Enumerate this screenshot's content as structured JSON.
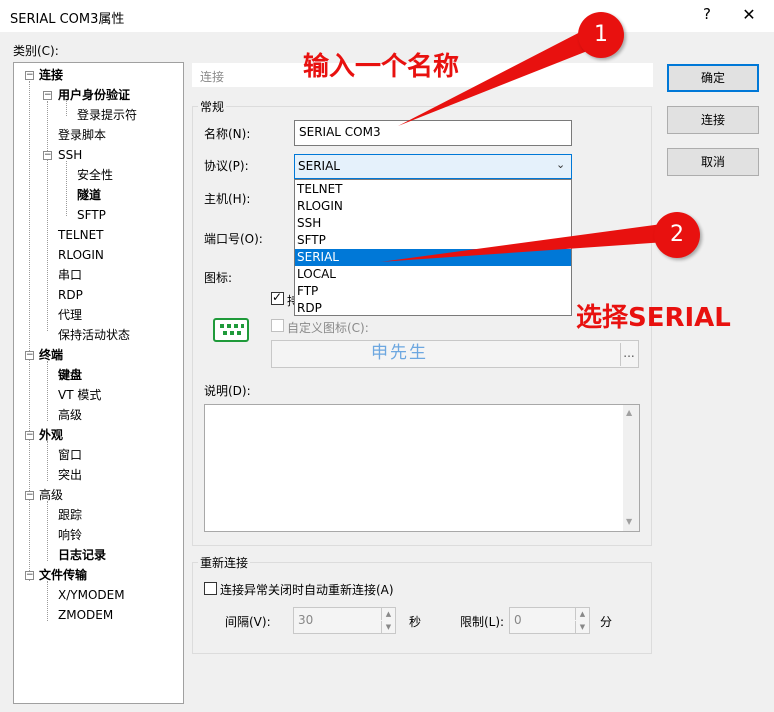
{
  "window": {
    "title": "SERIAL COM3属性",
    "help_glyph": "?",
    "close_glyph": "✕"
  },
  "category_label": "类别(C):",
  "tree": [
    {
      "label": "连接",
      "bold": true
    },
    {
      "label": "用户身份验证",
      "bold": true
    },
    {
      "label": "登录提示符",
      "bold": false
    },
    {
      "label": "登录脚本",
      "bold": false
    },
    {
      "label": "SSH",
      "bold": false
    },
    {
      "label": "安全性",
      "bold": false
    },
    {
      "label": "隧道",
      "bold": true
    },
    {
      "label": "SFTP",
      "bold": false
    },
    {
      "label": "TELNET",
      "bold": false
    },
    {
      "label": "RLOGIN",
      "bold": false
    },
    {
      "label": "串口",
      "bold": false
    },
    {
      "label": "RDP",
      "bold": false
    },
    {
      "label": "代理",
      "bold": false
    },
    {
      "label": "保持活动状态",
      "bold": false
    },
    {
      "label": "终端",
      "bold": true
    },
    {
      "label": "键盘",
      "bold": true
    },
    {
      "label": "VT 模式",
      "bold": false
    },
    {
      "label": "高级",
      "bold": false
    },
    {
      "label": "外观",
      "bold": true
    },
    {
      "label": "窗口",
      "bold": false
    },
    {
      "label": "突出",
      "bold": false
    },
    {
      "label": "高级",
      "bold": false
    },
    {
      "label": "跟踪",
      "bold": false
    },
    {
      "label": "响铃",
      "bold": false
    },
    {
      "label": "日志记录",
      "bold": true
    },
    {
      "label": "文件传输",
      "bold": true
    },
    {
      "label": "X/YMODEM",
      "bold": false
    },
    {
      "label": "ZMODEM",
      "bold": false
    }
  ],
  "section_header": "连接",
  "general": {
    "group_label": "常规",
    "name_label": "名称(N):",
    "name_value": "SERIAL COM3",
    "protocol_label": "协议(P):",
    "protocol_value": "SERIAL",
    "host_label": "主机(H):",
    "port_label": "端口号(O):",
    "icon_label": "图标:",
    "default_icon_check_partial": "持",
    "custom_icon_label": "自定义图标(C):",
    "browse_label": "...",
    "watermark": "申先生",
    "desc_label": "说明(D):"
  },
  "protocol_options": [
    "TELNET",
    "RLOGIN",
    "SSH",
    "SFTP",
    "SERIAL",
    "LOCAL",
    "FTP",
    "RDP"
  ],
  "reconnect": {
    "group_label": "重新连接",
    "check_label": "连接异常关闭时自动重新连接(A)",
    "interval_label": "间隔(V):",
    "interval_value": "30",
    "seconds_unit": "秒",
    "limit_label": "限制(L):",
    "limit_value": "0",
    "minutes_unit": "分"
  },
  "buttons": {
    "ok": "确定",
    "connect": "连接",
    "cancel": "取消"
  },
  "annotations": {
    "step1_number": "1",
    "step1_text": "输入一个名称",
    "step2_number": "2",
    "step2_text": "选择SERIAL"
  },
  "colors": {
    "selection": "#0078d7",
    "annotation": "#e8110f",
    "icon_green": "#1f9a3a"
  }
}
